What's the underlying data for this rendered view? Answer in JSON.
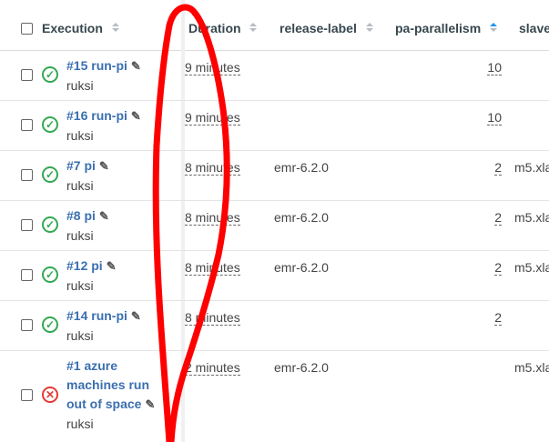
{
  "headers": {
    "execution": "Execution",
    "duration": "Duration",
    "release_label": "release-label",
    "pa_parallelism": "pa-parallelism",
    "slave": "slave"
  },
  "rows": [
    {
      "title": "#15 run-pi",
      "user": "ruksi",
      "status": "success",
      "duration": "9 minutes",
      "release": "",
      "parallelism": "10",
      "slave": ""
    },
    {
      "title": "#16 run-pi",
      "user": "ruksi",
      "status": "success",
      "duration": "9 minutes",
      "release": "",
      "parallelism": "10",
      "slave": ""
    },
    {
      "title": "#7 pi",
      "user": "ruksi",
      "status": "success",
      "duration": "8 minutes",
      "release": "emr-6.2.0",
      "parallelism": "2",
      "slave": "m5.xla"
    },
    {
      "title": "#8 pi",
      "user": "ruksi",
      "status": "success",
      "duration": "8 minutes",
      "release": "emr-6.2.0",
      "parallelism": "2",
      "slave": "m5.xla"
    },
    {
      "title": "#12 pi",
      "user": "ruksi",
      "status": "success",
      "duration": "8 minutes",
      "release": "emr-6.2.0",
      "parallelism": "2",
      "slave": "m5.xla"
    },
    {
      "title": "#14 run-pi",
      "user": "ruksi",
      "status": "success",
      "duration": "8 minutes",
      "release": "",
      "parallelism": "2",
      "slave": ""
    },
    {
      "title_lines": [
        "#1 azure",
        "machines run",
        "out of space"
      ],
      "user": "ruksi",
      "status": "failed",
      "duration": "2 minutes",
      "release": "emr-6.2.0",
      "parallelism": "",
      "slave": "m5.xla"
    }
  ],
  "icons": {
    "checkbox": "checkbox-icon",
    "success": "check-circle-icon",
    "failed": "x-circle-icon",
    "edit": "pencil-icon",
    "sort": "sort-arrows-icon"
  },
  "colors": {
    "link": "#3a6fb0",
    "success": "#34a853",
    "failed": "#e53935",
    "sort_active": "#2196f3",
    "annotation": "#ff0000"
  }
}
